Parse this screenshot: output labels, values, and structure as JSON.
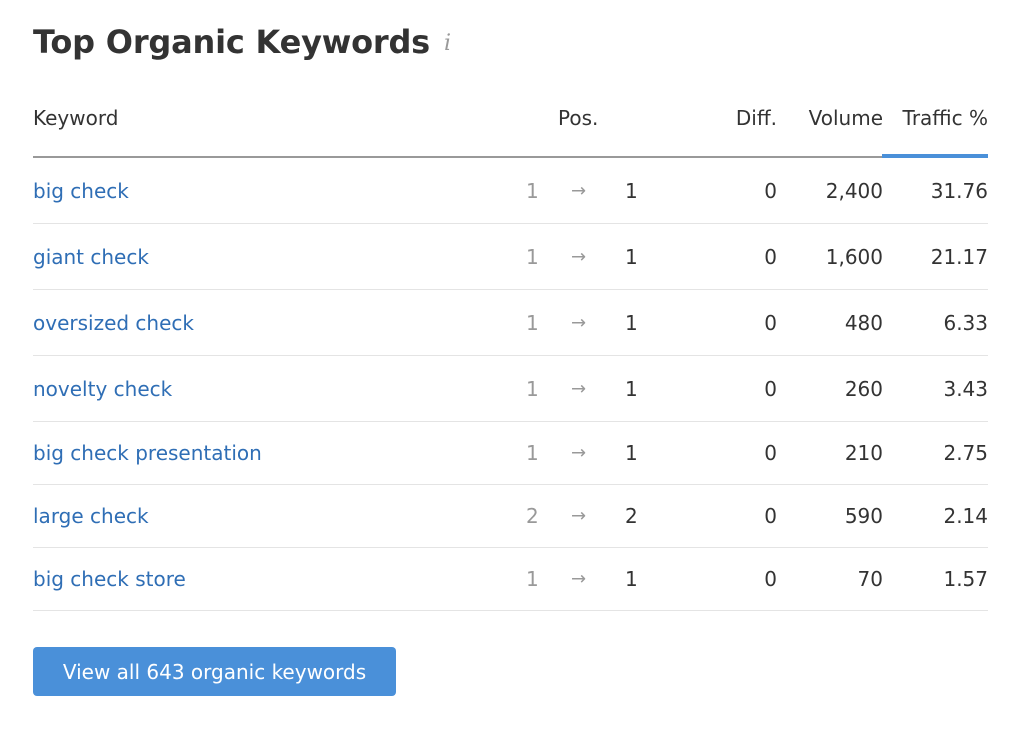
{
  "widget": {
    "title": "Top Organic Keywords",
    "info_icon": "i",
    "columns": {
      "keyword": "Keyword",
      "pos": "Pos.",
      "diff": "Diff.",
      "volume": "Volume",
      "traffic": "Traffic %"
    },
    "sorted_column": "traffic",
    "accent_color": "#4a90d9",
    "link_color": "#2f6eb5",
    "rows": [
      {
        "keyword": "big check",
        "prev_pos": "1",
        "arrow": "→",
        "pos": "1",
        "diff": "0",
        "volume": "2,400",
        "traffic": "31.76"
      },
      {
        "keyword": "giant check",
        "prev_pos": "1",
        "arrow": "→",
        "pos": "1",
        "diff": "0",
        "volume": "1,600",
        "traffic": "21.17"
      },
      {
        "keyword": "oversized check",
        "prev_pos": "1",
        "arrow": "→",
        "pos": "1",
        "diff": "0",
        "volume": "480",
        "traffic": "6.33"
      },
      {
        "keyword": "novelty check",
        "prev_pos": "1",
        "arrow": "→",
        "pos": "1",
        "diff": "0",
        "volume": "260",
        "traffic": "3.43"
      },
      {
        "keyword": "big check presentation",
        "prev_pos": "1",
        "arrow": "→",
        "pos": "1",
        "diff": "0",
        "volume": "210",
        "traffic": "2.75"
      },
      {
        "keyword": "large check",
        "prev_pos": "2",
        "arrow": "→",
        "pos": "2",
        "diff": "0",
        "volume": "590",
        "traffic": "2.14"
      },
      {
        "keyword": "big check store",
        "prev_pos": "1",
        "arrow": "→",
        "pos": "1",
        "diff": "0",
        "volume": "70",
        "traffic": "1.57"
      }
    ],
    "view_all_label": "View all 643 organic keywords"
  }
}
